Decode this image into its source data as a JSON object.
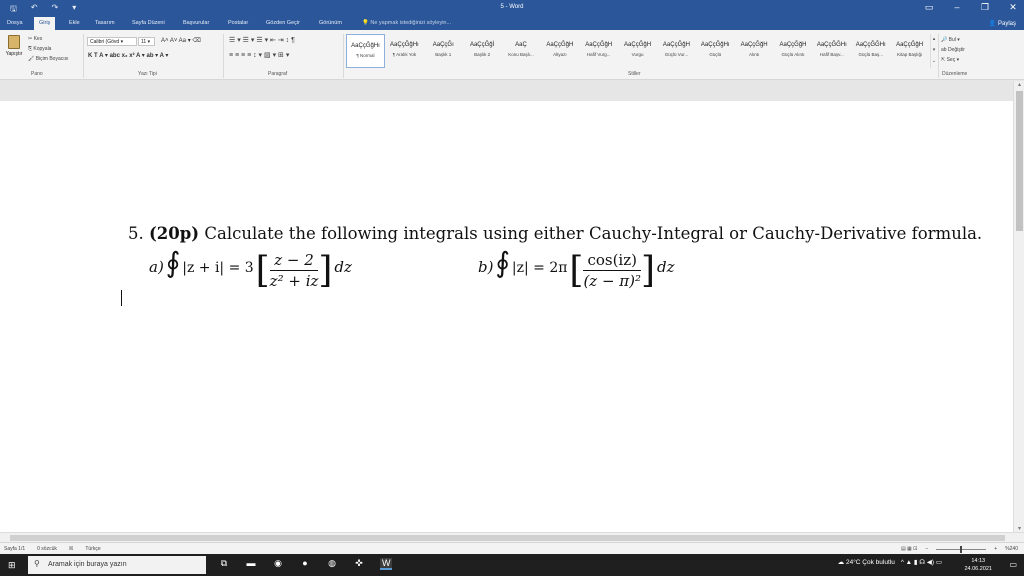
{
  "window": {
    "title": "5 - Word",
    "min": "–",
    "max": "❐",
    "close": "✕",
    "ribbon_opts": "▭"
  },
  "qat": {
    "save": "🖫",
    "undo": "↶",
    "redo": "↷",
    "customize": "▾"
  },
  "tabs": [
    {
      "label": "Dosya"
    },
    {
      "label": "Giriş"
    },
    {
      "label": "Ekle"
    },
    {
      "label": "Tasarım"
    },
    {
      "label": "Sayfa Düzeni"
    },
    {
      "label": "Başvurular"
    },
    {
      "label": "Postalar"
    },
    {
      "label": "Gözden Geçir"
    },
    {
      "label": "Görünüm"
    }
  ],
  "tell_me": "💡 Ne yapmak istediğinizi söyleyin...",
  "share": "Paylaş",
  "ribbon": {
    "paste": "Yapıştır",
    "cut": "✂ Kes",
    "copy": "⎘ Kopyala",
    "format_painter": "🖌 Biçim Boyacısı",
    "clipboard_group": "Pano",
    "font_name": "Calibri (Gövd ▾",
    "font_size": "11 ▾",
    "grow_shrink": "A˄ A˅  Aa ▾  ⌫",
    "bold_row": "K  T  A ▾  abc  x₂  x²   A ▾  ab ▾  A ▾",
    "font_group": "Yazı Tipi",
    "para_row1": "☰ ▾  ☰ ▾  ☰ ▾  ⇤  ⇥  ↕  ¶",
    "para_row2": "≡  ≡  ≡  ≡   ↕ ▾   ▨ ▾  ⊞ ▾",
    "para_group": "Paragraf",
    "styles_group": "Stiller",
    "styles": [
      {
        "sample": "AaÇçĞğHı",
        "name": "¶ Normal"
      },
      {
        "sample": "AaÇçĞğHı",
        "name": "¶ Aralık Yok"
      },
      {
        "sample": "AaÇçĞı",
        "name": "Başlık 1"
      },
      {
        "sample": "AaÇçĞğİ",
        "name": "Başlık 2"
      },
      {
        "sample": "AaÇ",
        "name": "Konu Başlı..."
      },
      {
        "sample": "AaÇçĞğH",
        "name": "Altyazı"
      },
      {
        "sample": "AaÇçĞğH",
        "name": "Hafif Vurg..."
      },
      {
        "sample": "AaÇçĞğH",
        "name": "Vurgu"
      },
      {
        "sample": "AaÇçĞğH",
        "name": "Güçlü Vur..."
      },
      {
        "sample": "AaÇçĞğHı",
        "name": "Güçlü"
      },
      {
        "sample": "AaÇçĞğH",
        "name": "Alıntı"
      },
      {
        "sample": "AaÇçĞğH",
        "name": "Güçlü Alıntı"
      },
      {
        "sample": "AaÇçĞĞHı",
        "name": "Hafif Başv..."
      },
      {
        "sample": "AaÇçĞĞHı",
        "name": "Güçlü Baş..."
      },
      {
        "sample": "AaÇçĞğH",
        "name": "Kitap Başlığı"
      }
    ],
    "find": "🔎 Bul ▾",
    "replace": "ab Değiştir",
    "select": "⇱ Seç ▾",
    "edit_group": "Düzenleme"
  },
  "document": {
    "q_number": "5.",
    "q_points": "(20p)",
    "q_text": "Calculate the following integrals using either Cauchy-Integral or Cauchy-Derivative formula.",
    "a": {
      "label": "a)",
      "contour": "|z + i| = 3",
      "num": "z − 2",
      "den": "z² + iz",
      "dz": "dz"
    },
    "b": {
      "label": "b)",
      "contour": "|z| = 2π",
      "num": "cos(iz)",
      "den": "(z − π)²",
      "dz": "dz"
    }
  },
  "status": {
    "page": "Sayfa 1/1",
    "words": "0 sözcük",
    "proof_icon": "☒",
    "language": "Türkçe",
    "views": "▤  ▦  ⊡",
    "zoom_minus": "−",
    "zoom_plus": "+",
    "zoom_value": "%240"
  },
  "taskbar": {
    "start": "⊞",
    "search_placeholder": "Aramak için buraya yazın",
    "search_icon": "⚲",
    "apps": [
      "⧉",
      "▬",
      "◉",
      "●",
      "◍",
      "✜",
      "W"
    ],
    "weather": "☁ 24°C  Çok bulutlu",
    "tray": "^  ▲  ▮  ☊  ◀)  ▭",
    "time": "14:13",
    "date": "24.06.2021",
    "notif": "▭"
  }
}
